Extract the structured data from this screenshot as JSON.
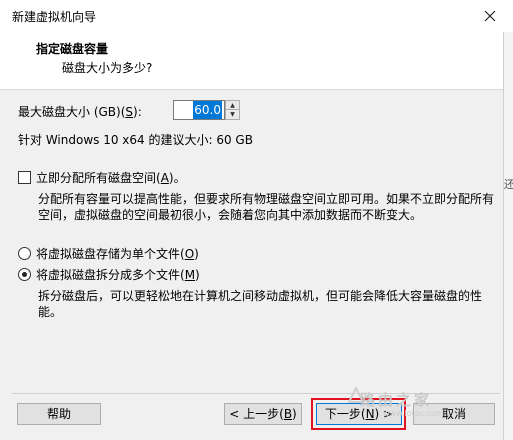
{
  "window": {
    "title": "新建虚拟机向导"
  },
  "header": {
    "title": "指定磁盘容量",
    "subtitle": "磁盘大小为多少?"
  },
  "disk": {
    "label_prefix": "最大磁盘大小 (GB)(",
    "label_key": "S",
    "label_suffix": "):",
    "value": "60.0",
    "recommend": "针对 Windows 10 x64 的建议大小: 60 GB"
  },
  "allocate": {
    "label_prefix": "立即分配所有磁盘空间(",
    "label_key": "A",
    "label_suffix": ")。",
    "checked": false,
    "description": "分配所有容量可以提高性能，但要求所有物理磁盘空间立即可用。如果不立即分配所有空间，虚拟磁盘的空间最初很小，会随着您向其中添加数据而不断变大。"
  },
  "storage": {
    "single": {
      "label_prefix": "将虚拟磁盘存储为单个文件(",
      "label_key": "O",
      "label_suffix": ")",
      "selected": false
    },
    "multi": {
      "label_prefix": "将虚拟磁盘拆分成多个文件(",
      "label_key": "M",
      "label_suffix": ")",
      "selected": true
    },
    "description": "拆分磁盘后，可以更轻松地在计算机之间移动虚拟机，但可能会降低大容量磁盘的性能。"
  },
  "buttons": {
    "help": "帮助",
    "back_prefix": "< 上一步(",
    "back_key": "B",
    "back_suffix": ")",
    "next_prefix": "下一步(",
    "next_key": "N",
    "next_suffix": ") >",
    "cancel": "取消"
  },
  "background": {
    "edge_glyph": "还"
  },
  "watermark": {
    "text": "路由之家",
    "url": "www.lotpc.com"
  },
  "colors": {
    "selection": "#0078d7",
    "highlight_outline": "#e0141e"
  }
}
